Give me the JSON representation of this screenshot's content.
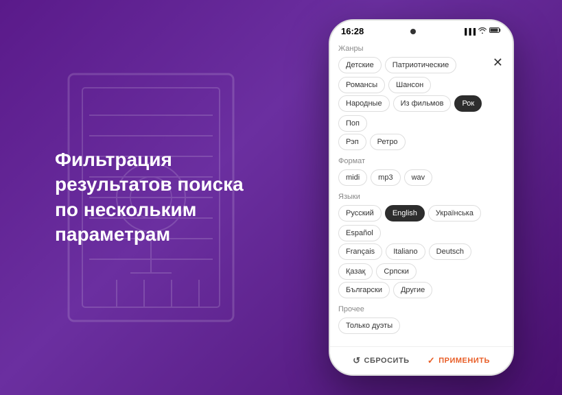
{
  "background": {
    "color_start": "#5a1a8a",
    "color_end": "#4a1070"
  },
  "left_text": {
    "line1": "Фильтрация",
    "line2": "результатов поиска",
    "line3": "по нескольким",
    "line4": "параметрам"
  },
  "phone": {
    "status_bar": {
      "time": "16:28",
      "signal": "▲",
      "wifi": "wifi",
      "battery": "bat"
    },
    "close_button_label": "✕",
    "sections": [
      {
        "id": "genres",
        "title": "Жанры",
        "tags": [
          {
            "label": "Детские",
            "active": false
          },
          {
            "label": "Патриотические",
            "active": false
          },
          {
            "label": "Романсы",
            "active": false
          },
          {
            "label": "Шансон",
            "active": false
          },
          {
            "label": "Народные",
            "active": false
          },
          {
            "label": "Из фильмов",
            "active": false
          },
          {
            "label": "Рок",
            "active": true
          },
          {
            "label": "Поп",
            "active": false
          },
          {
            "label": "Рэп",
            "active": false
          },
          {
            "label": "Ретро",
            "active": false
          }
        ]
      },
      {
        "id": "format",
        "title": "Формат",
        "tags": [
          {
            "label": "midi",
            "active": false
          },
          {
            "label": "mp3",
            "active": false
          },
          {
            "label": "wav",
            "active": false
          }
        ]
      },
      {
        "id": "languages",
        "title": "Языки",
        "tags": [
          {
            "label": "Русский",
            "active": false
          },
          {
            "label": "English",
            "active": true
          },
          {
            "label": "Українська",
            "active": false
          },
          {
            "label": "Español",
            "active": false
          },
          {
            "label": "Français",
            "active": false
          },
          {
            "label": "Italiano",
            "active": false
          },
          {
            "label": "Deutsch",
            "active": false
          },
          {
            "label": "Қазақ",
            "active": false
          },
          {
            "label": "Српски",
            "active": false
          },
          {
            "label": "Български",
            "active": false
          },
          {
            "label": "Другие",
            "active": false
          }
        ]
      },
      {
        "id": "other",
        "title": "Прочее",
        "tags": [
          {
            "label": "Только дуэты",
            "active": false
          }
        ]
      }
    ],
    "actions": {
      "reset_label": "СБРОСИТЬ",
      "apply_label": "ПРИМЕНИТЬ"
    }
  }
}
